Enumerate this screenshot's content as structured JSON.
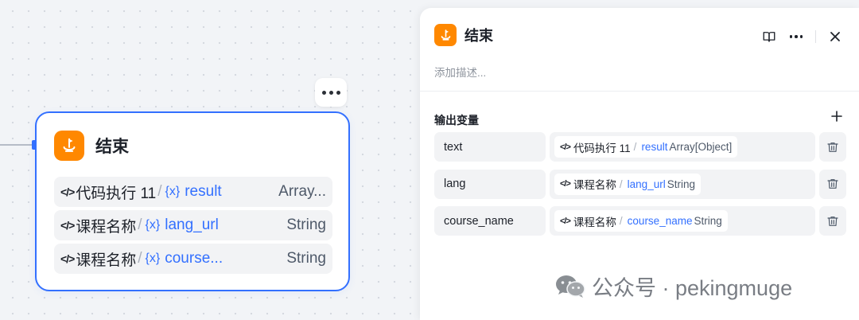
{
  "node": {
    "title": "结束",
    "rows": [
      {
        "code_glyph": "</>",
        "source": "代码执行 11",
        "slash": "/",
        "var_glyph": "{x}",
        "var": "result",
        "type": "Array..."
      },
      {
        "code_glyph": "</>",
        "source": "课程名称",
        "slash": "/",
        "var_glyph": "{x}",
        "var": "lang_url",
        "type": "String"
      },
      {
        "code_glyph": "</>",
        "source": "课程名称",
        "slash": "/",
        "var_glyph": "{x}",
        "var": "course...",
        "type": "String"
      }
    ]
  },
  "panel": {
    "title": "结束",
    "description_placeholder": "添加描述...",
    "section_title": "输出变量",
    "outputs": [
      {
        "name": "text",
        "code_glyph": "</>",
        "source": "代码执行 11",
        "slash": "/",
        "var": "result",
        "type": "Array[Object]"
      },
      {
        "name": "lang",
        "code_glyph": "</>",
        "source": "课程名称",
        "slash": "/",
        "var": "lang_url",
        "type": "String"
      },
      {
        "name": "course_name",
        "code_glyph": "</>",
        "source": "课程名称",
        "slash": "/",
        "var": "course_name",
        "type": "String"
      }
    ]
  },
  "watermark": {
    "text": "公众号 · pekingmuge"
  },
  "colors": {
    "accent": "#3370ff",
    "end_icon": "#ff8800"
  }
}
